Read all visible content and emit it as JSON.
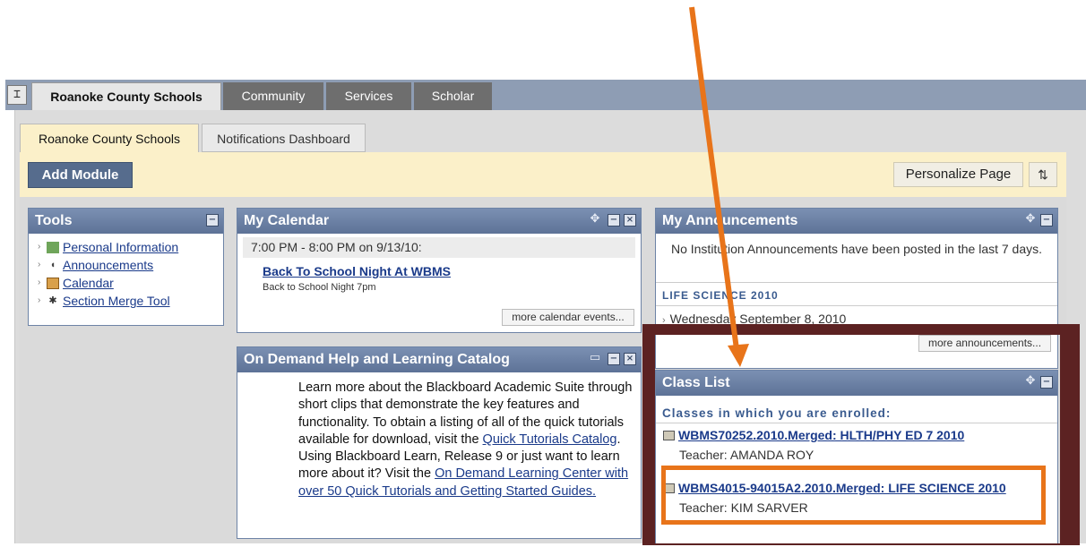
{
  "top_tabs": [
    "Roanoke County Schools",
    "Community",
    "Services",
    "Scholar"
  ],
  "nav_toggle_glyph": "⌶",
  "sub_tabs": [
    "Roanoke County Schools",
    "Notifications Dashboard"
  ],
  "toolbar": {
    "add_module": "Add Module",
    "personalize": "Personalize Page",
    "sort_glyph": "⇅"
  },
  "tools": {
    "title": "Tools",
    "items": [
      {
        "label": "Personal Information",
        "icon": "person-icon"
      },
      {
        "label": "Announcements",
        "icon": "megaphone-icon"
      },
      {
        "label": "Calendar",
        "icon": "calendar-icon"
      },
      {
        "label": "Section Merge Tool",
        "icon": "tools-icon"
      }
    ]
  },
  "calendar": {
    "title": "My Calendar",
    "event_time": "7:00 PM - 8:00 PM on 9/13/10:",
    "event_title": "Back To School Night At WBMS",
    "event_desc": "Back to School Night 7pm",
    "more": "more calendar events..."
  },
  "help": {
    "title": "On Demand Help and Learning Catalog",
    "p1": "Learn more about the Blackboard Academic Suite through short clips that demonstrate the key features and functionality. To obtain a listing of all of the quick tutorials available for download, visit the ",
    "link1": "Quick Tutorials Catalog",
    "p1_end": ".",
    "p2": "Using Blackboard Learn, Release 9 or just want to learn more about it? Visit the ",
    "link2": "On Demand Learning Center with over 50 Quick Tutorials and Getting Started Guides."
  },
  "announcements": {
    "title": "My Announcements",
    "none_text": "No Institution Announcements have been posted in the last 7 days.",
    "course": "LIFE SCIENCE 2010",
    "date": "Wednesday September 8, 2010",
    "more": "more announcements..."
  },
  "class_list": {
    "title": "Class List",
    "heading": "Classes in which you are enrolled:",
    "classes": [
      {
        "name": "WBMS70252.2010.Merged: HLTH/PHY ED 7 2010",
        "teacher": "Teacher: AMANDA ROY"
      },
      {
        "name": "WBMS4015-94015A2.2010.Merged: LIFE SCIENCE 2010",
        "teacher": "Teacher: KIM SARVER"
      }
    ]
  },
  "colors": {
    "annotation_arrow": "#e8741a",
    "annotation_frame": "#5c2222",
    "module_header": "#5d7297"
  }
}
